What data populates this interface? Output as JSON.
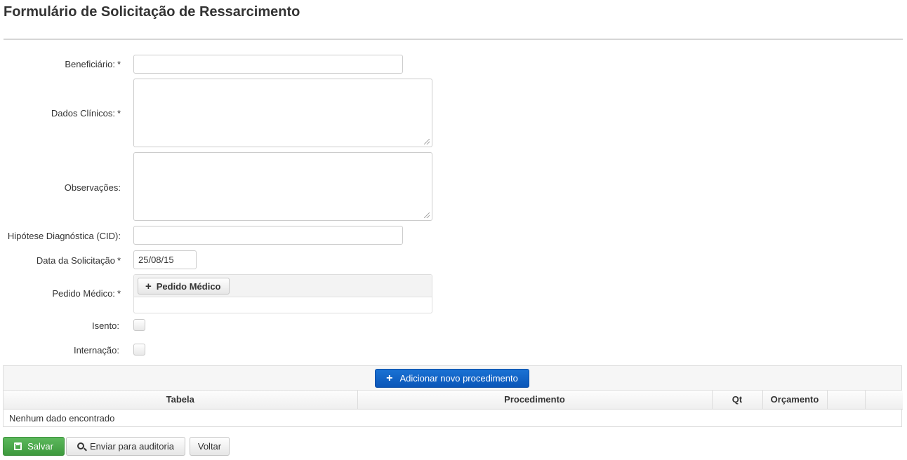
{
  "page": {
    "title": "Formulário de Solicitação de Ressarcimento"
  },
  "form": {
    "beneficiario": {
      "label": "Beneficiário:",
      "required": "*",
      "value": ""
    },
    "dados_clinicos": {
      "label": "Dados Clínicos:",
      "required": "*",
      "value": ""
    },
    "observacoes": {
      "label": "Observações:",
      "value": ""
    },
    "hipotese": {
      "label": "Hipótese Diagnóstica (CID):",
      "value": ""
    },
    "data_solicitacao": {
      "label": "Data da Solicitação",
      "required": "*",
      "value": "25/08/15"
    },
    "pedido_medico": {
      "label": "Pedido Médico:",
      "required": "*",
      "button_label": "Pedido Médico"
    },
    "isento": {
      "label": "Isento:",
      "checked": false
    },
    "internacao": {
      "label": "Internação:",
      "checked": false
    }
  },
  "procedures": {
    "add_button_label": "Adicionar novo procedimento",
    "columns": [
      "Tabela",
      "Procedimento",
      "Qt",
      "Orçamento",
      "",
      ""
    ],
    "empty_message": "Nenhum dado encontrado"
  },
  "actions": {
    "save_label": "Salvar",
    "audit_label": "Enviar para auditoria",
    "back_label": "Voltar"
  },
  "colors": {
    "primary_button": "#0a56b8",
    "save_button": "#4cae4c"
  }
}
